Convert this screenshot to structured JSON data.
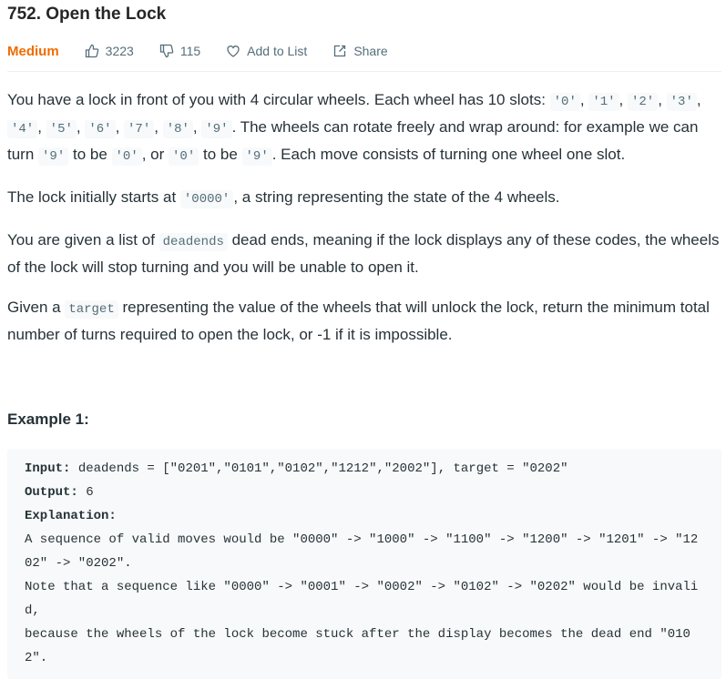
{
  "problem": {
    "title": "752. Open the Lock",
    "difficulty": "Medium",
    "likes": "3223",
    "dislikes": "115",
    "add_to_list": "Add to List",
    "share": "Share"
  },
  "description": {
    "p1": {
      "t1": "You have a lock in front of you with 4 circular wheels. Each wheel has 10 slots: ",
      "slots": [
        "'0'",
        "'1'",
        "'2'",
        "'3'",
        "'4'",
        "'5'",
        "'6'",
        "'7'",
        "'8'",
        "'9'"
      ],
      "sep": ", ",
      "t2": ". The wheels can rotate freely and wrap around: for example we can turn ",
      "c1": "'9'",
      "t3": " to be ",
      "c2": "'0'",
      "t4": ", or ",
      "c3": "'0'",
      "t5": " to be ",
      "c4": "'9'",
      "t6": ". Each move consists of turning one wheel one slot."
    },
    "p2": {
      "t1": "The lock initially starts at ",
      "c1": "'0000'",
      "t2": ", a string representing the state of the 4 wheels."
    },
    "p3": {
      "t1": "You are given a list of ",
      "c1": "deadends",
      "t2": " dead ends, meaning if the lock displays any of these codes, the wheels of the lock will stop turning and you will be unable to open it."
    },
    "p4": {
      "t1": "Given a ",
      "c1": "target",
      "t2": " representing the value of the wheels that will unlock the lock, return the minimum total number of turns required to open the lock, or -1 if it is impossible."
    }
  },
  "example1": {
    "heading": "Example 1:",
    "input_label": "Input:",
    "input_value": " deadends = [\"0201\",\"0101\",\"0102\",\"1212\",\"2002\"], target = \"0202\"",
    "output_label": "Output:",
    "output_value": " 6",
    "explanation_label": "Explanation:",
    "explanation_text": "A sequence of valid moves would be \"0000\" -> \"1000\" -> \"1100\" -> \"1200\" -> \"1201\" -> \"1202\" -> \"0202\".\nNote that a sequence like \"0000\" -> \"0001\" -> \"0002\" -> \"0102\" -> \"0202\" would be invalid,\nbecause the wheels of the lock become stuck after the display becomes the dead end \"0102\"."
  }
}
